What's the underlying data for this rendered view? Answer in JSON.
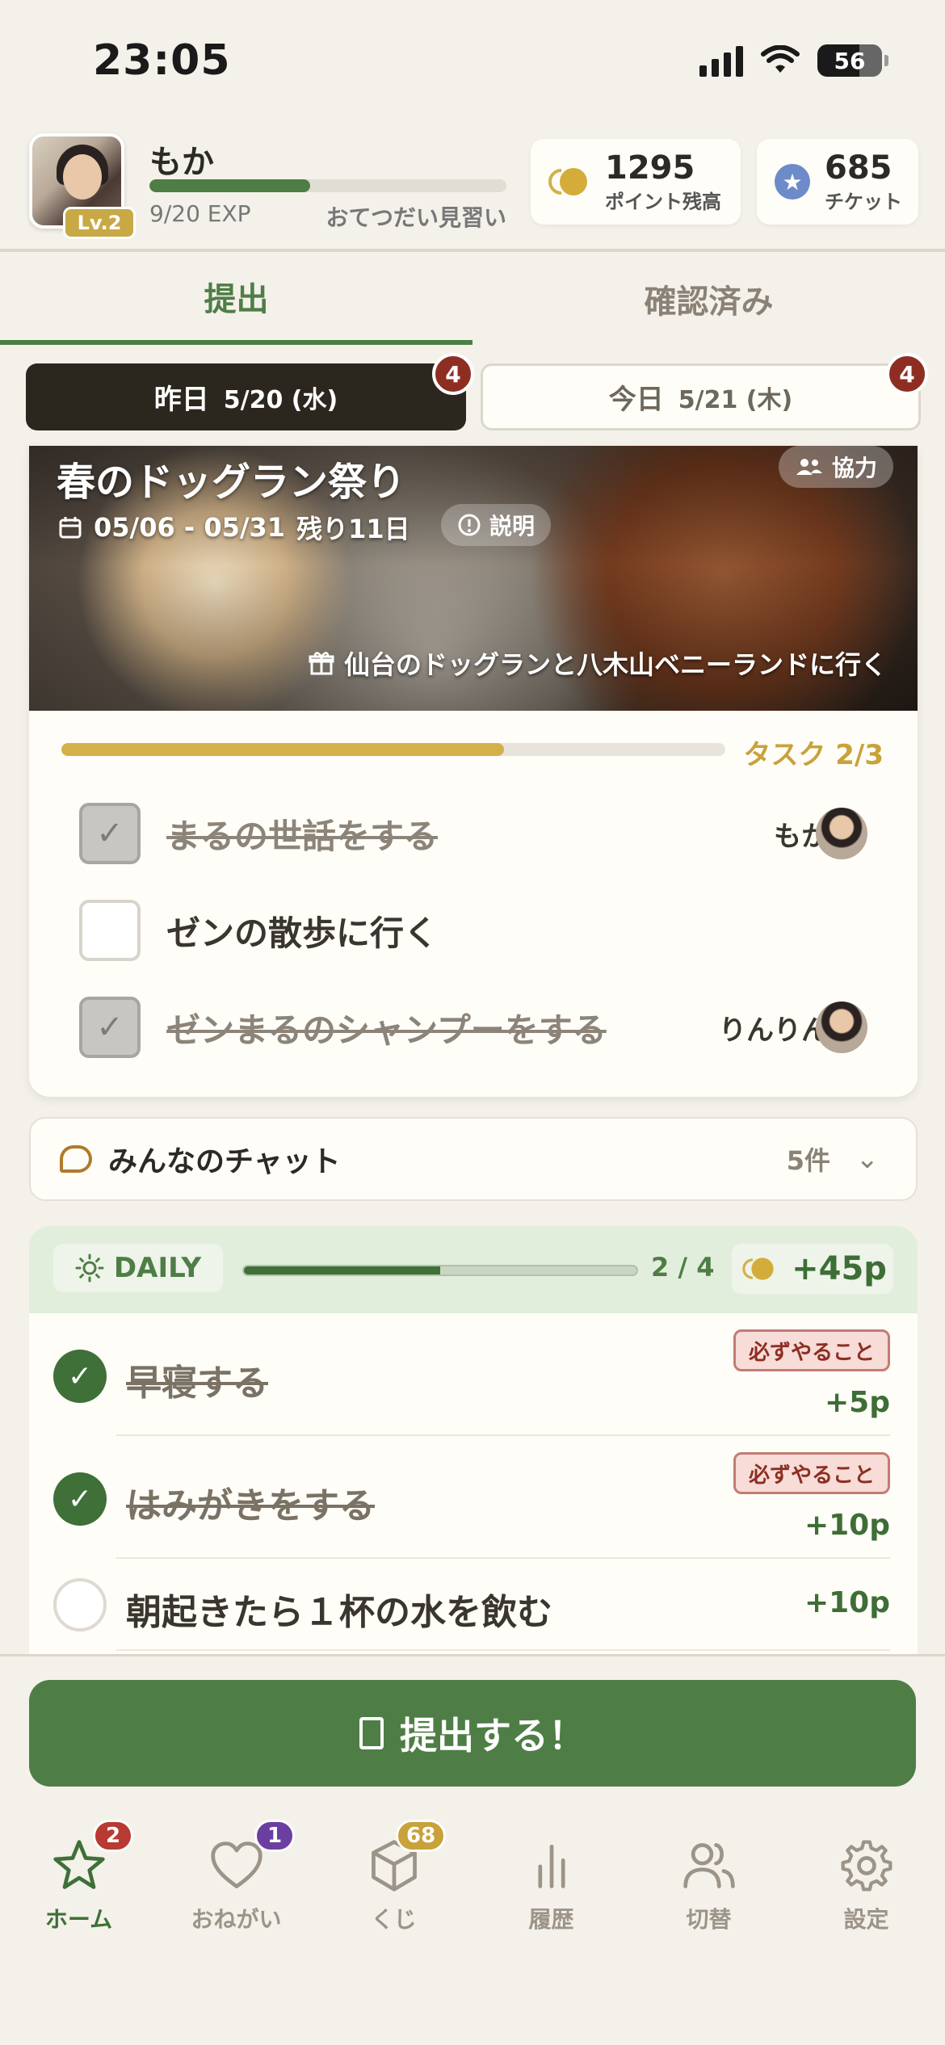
{
  "status_bar": {
    "time": "23:05",
    "battery": "56"
  },
  "profile": {
    "name": "もか",
    "level": "Lv.2",
    "exp_text": "9/20 EXP",
    "exp_progress": 0.45,
    "rank": "おてつだい見習い"
  },
  "stats": {
    "points": {
      "value": "1295",
      "label": "ポイント残高",
      "icon": "coin-icon"
    },
    "tickets": {
      "value": "685",
      "label": "チケット",
      "icon": "star-icon"
    }
  },
  "tabs": [
    {
      "label": "提出",
      "active": true
    },
    {
      "label": "確認済み",
      "active": false
    }
  ],
  "days": {
    "yesterday": {
      "label": "昨日",
      "date": "5/20 (水)",
      "count": "4"
    },
    "today": {
      "label": "今日",
      "date": "5/21 (木)",
      "count": "4"
    }
  },
  "event": {
    "title": "春のドッグラン祭り",
    "coop_label": "協力",
    "dates": "05/06 - 05/31",
    "remaining": "残り11日",
    "explain_label": "説明",
    "reward": "仙台のドッグランと八木山ベニーランドに行く",
    "task_label": "タスク 2/3",
    "task_progress": 0.667,
    "tasks": [
      {
        "label": "まるの世話をする",
        "done": true,
        "assignee": "もか"
      },
      {
        "label": "ゼンの散歩に行く",
        "done": false,
        "assignee": ""
      },
      {
        "label": "ゼンまるのシャンプーをする",
        "done": true,
        "assignee": "りんりん"
      }
    ]
  },
  "chat": {
    "label": "みんなのチャット",
    "count": "5件"
  },
  "daily": {
    "label": "DAILY",
    "count": "2 / 4",
    "progress": 0.5,
    "points": "+45p",
    "items": [
      {
        "label": "早寝する",
        "done": true,
        "badge": "必ずやること",
        "points": "+5p"
      },
      {
        "label": "はみがきをする",
        "done": true,
        "badge": "必ずやること",
        "points": "+10p"
      },
      {
        "label": "朝起きたら１杯の水を飲む",
        "done": false,
        "badge": "",
        "points": "+10p"
      }
    ]
  },
  "submit": {
    "label": "提出する！"
  },
  "nav": [
    {
      "label": "ホーム",
      "icon": "star-outline-icon",
      "badge": "2",
      "badge_color": "#b83a32",
      "active": true
    },
    {
      "label": "おねがい",
      "icon": "heart-icon",
      "badge": "1",
      "badge_color": "#6a3fa0",
      "active": false
    },
    {
      "label": "くじ",
      "icon": "box-icon",
      "badge": "68",
      "badge_color": "#c8a23a",
      "active": false
    },
    {
      "label": "履歴",
      "icon": "bar-chart-icon",
      "badge": "",
      "active": false
    },
    {
      "label": "切替",
      "icon": "users-icon",
      "badge": "",
      "active": false
    },
    {
      "label": "設定",
      "icon": "gear-icon",
      "badge": "",
      "active": false
    }
  ]
}
